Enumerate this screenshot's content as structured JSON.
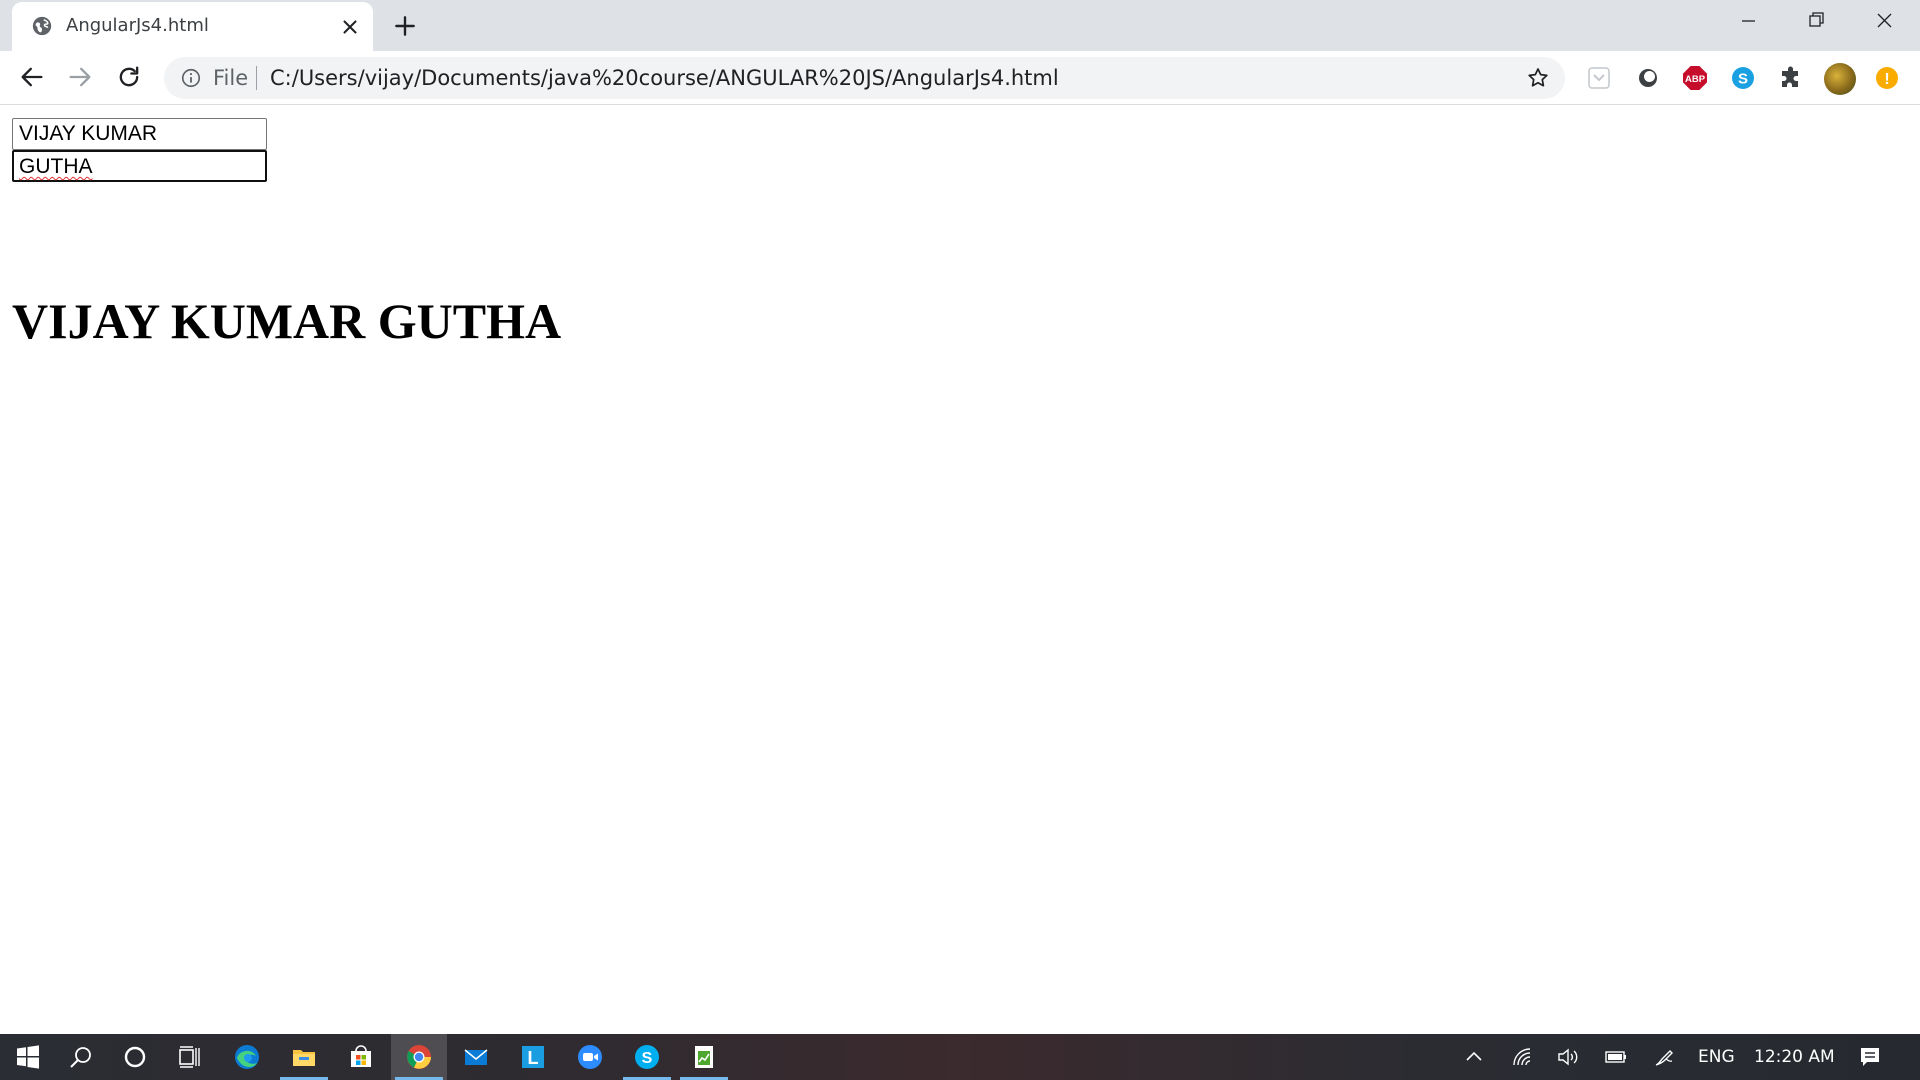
{
  "browser": {
    "tab_title": "AngularJs4.html",
    "omnibox": {
      "scheme_label": "File",
      "url": "C:/Users/vijay/Documents/java%20course/ANGULAR%20JS/AngularJs4.html"
    },
    "extensions": [
      "pocket-icon",
      "circle-extension-icon",
      "adblock-plus-icon",
      "skype-icon",
      "extensions-puzzle-icon",
      "profile-avatar",
      "update-alert-icon"
    ],
    "extension_labels": {
      "adblock": "ABP",
      "skype": "S",
      "alert": "!"
    }
  },
  "page": {
    "first_name": "VIJAY KUMAR",
    "last_name": "GUTHA",
    "full_name": "VIJAY KUMAR GUTHA"
  },
  "taskbar": {
    "apps": [
      "start-icon",
      "search-icon",
      "cortana-icon",
      "task-view-icon",
      "edge-icon",
      "file-explorer-icon",
      "store-icon",
      "chrome-icon",
      "mail-icon",
      "l-app-icon",
      "zoom-icon",
      "skype-icon",
      "notepad-chart-icon"
    ],
    "language": "ENG",
    "time": "12:20 AM"
  },
  "colors": {
    "tabstrip": "#dee1e6",
    "omnibox": "#f1f3f4",
    "taskbar": "#2a2d33",
    "taskbar_underline": "#76b9ed"
  }
}
